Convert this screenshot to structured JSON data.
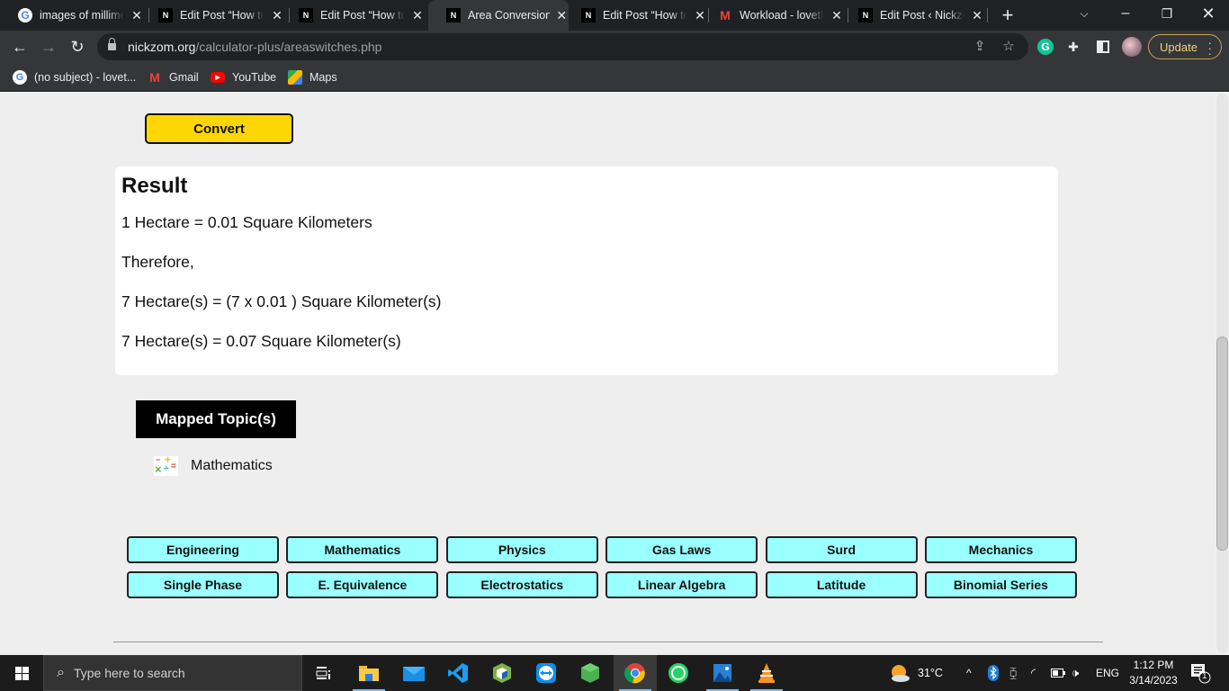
{
  "browser": {
    "tabs": [
      {
        "title": "images of millime",
        "favicon": "google-icon",
        "active": false
      },
      {
        "title": "Edit Post “How to",
        "favicon": "nickzom-icon",
        "active": false
      },
      {
        "title": "Edit Post “How to",
        "favicon": "nickzom-icon",
        "active": false
      },
      {
        "title": "Area Conversion",
        "favicon": "nickzom-icon",
        "active": true
      },
      {
        "title": "Edit Post “How to",
        "favicon": "nickzom-icon",
        "active": false
      },
      {
        "title": "Workload - lovetl",
        "favicon": "gmail-icon",
        "active": false
      },
      {
        "title": "Edit Post ‹ Nickzo",
        "favicon": "nickzom-icon",
        "active": false
      }
    ],
    "close_glyph": "✕",
    "new_tab_glyph": "+",
    "url_host": "nickzom.org",
    "url_path": "/calculator-plus/areaswitches.php",
    "update_label": "Update",
    "bookmarks": [
      {
        "label": "(no subject) - lovet...",
        "icon": "google-icon"
      },
      {
        "label": "Gmail",
        "icon": "gmail-icon"
      },
      {
        "label": "YouTube",
        "icon": "youtube-icon"
      },
      {
        "label": "Maps",
        "icon": "maps-icon"
      }
    ]
  },
  "page": {
    "convert_label": "Convert",
    "result": {
      "heading": "Result",
      "lines": [
        "1 Hectare = 0.01 Square Kilometers",
        "Therefore,",
        "7 Hectare(s) = (7 x 0.01 ) Square Kilometer(s)",
        "7 Hectare(s) = 0.07 Square Kilometer(s)"
      ]
    },
    "mapped_topics_title": "Mapped Topic(s)",
    "mapped_topic": "Mathematics",
    "topic_links": [
      "Engineering",
      "Mathematics",
      "Physics",
      "Gas Laws",
      "Surd",
      "Mechanics",
      "Single Phase",
      "E. Equivalence",
      "Electrostatics",
      "Linear Algebra",
      "Latitude",
      "Binomial Series"
    ],
    "colors": {
      "convert_button": "#ffd700",
      "topic_button": "#99ffff",
      "mapped_title_bg": "#000000"
    }
  },
  "taskbar": {
    "search_placeholder": "Type here to search",
    "weather": "31°C",
    "language": "ENG",
    "time": "1:12 PM",
    "date": "3/14/2023",
    "notification_count": "1"
  }
}
